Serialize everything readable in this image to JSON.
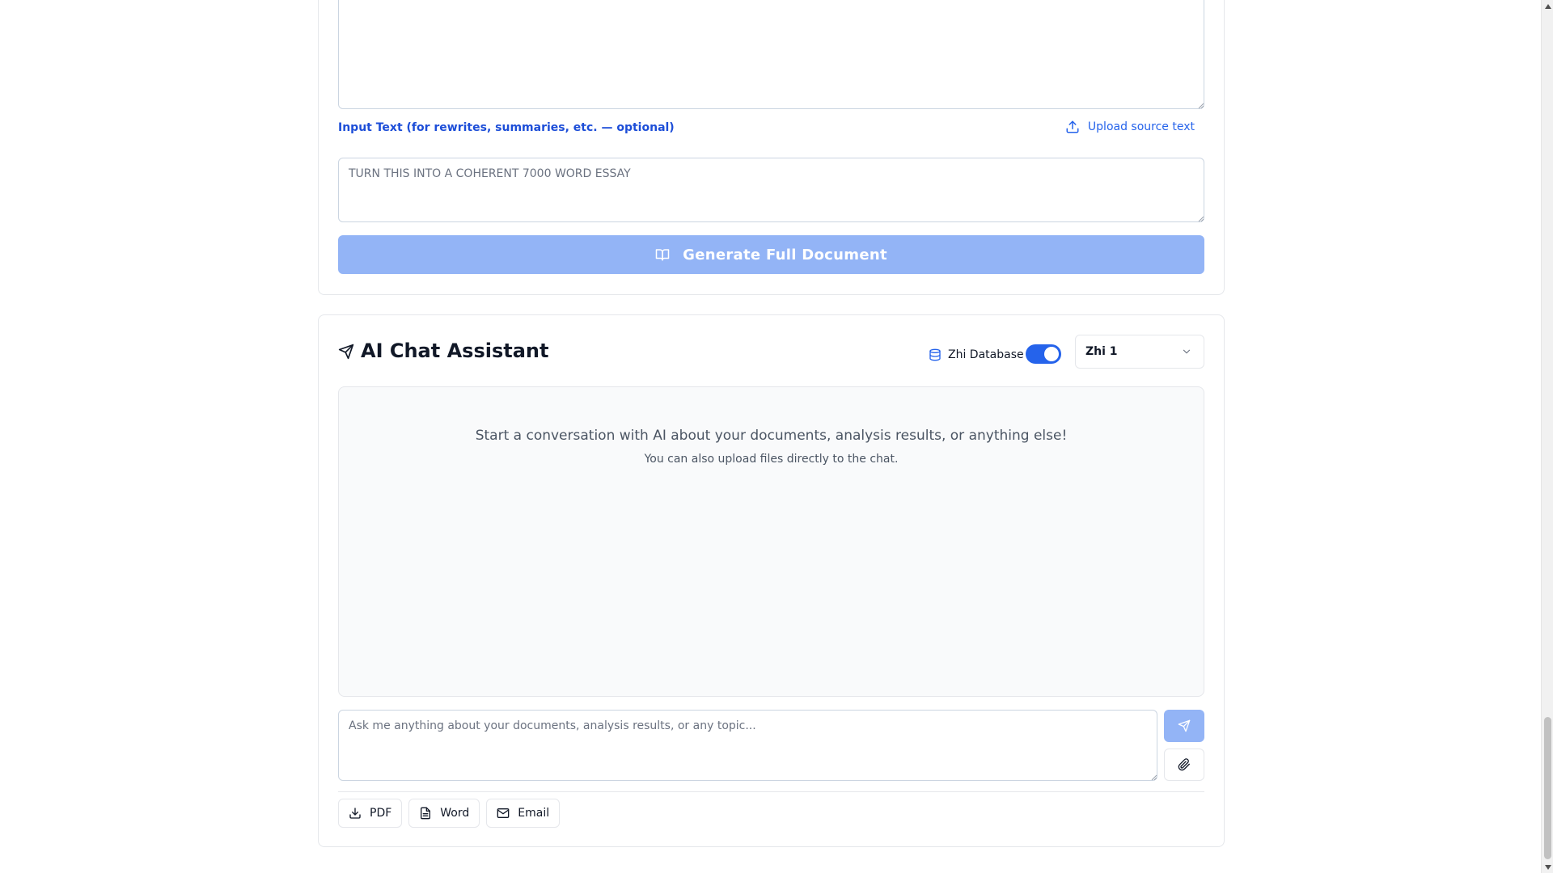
{
  "top_card": {
    "prompt_value": "",
    "input_label": "Input Text (for rewrites, summaries, etc. — optional)",
    "upload_label": "Upload source text",
    "input_value": "TURN THIS INTO A COHERENT 7000 WORD ESSAY",
    "generate_label": "Generate Full Document"
  },
  "chat": {
    "title": "AI Chat Assistant",
    "database_label": "Zhi Database",
    "database_enabled": true,
    "model_selected": "Zhi 1",
    "empty_main": "Start a conversation with AI about your documents, analysis results, or anything else!",
    "empty_sub": "You can also upload files directly to the chat.",
    "input_placeholder": "Ask me anything about your documents, analysis results, or any topic...",
    "export": {
      "pdf_label": "PDF",
      "word_label": "Word",
      "email_label": "Email"
    }
  },
  "colors": {
    "accent": "#2563eb",
    "accent_disabled": "#93b4f6",
    "label_blue": "#1d4ed8"
  }
}
